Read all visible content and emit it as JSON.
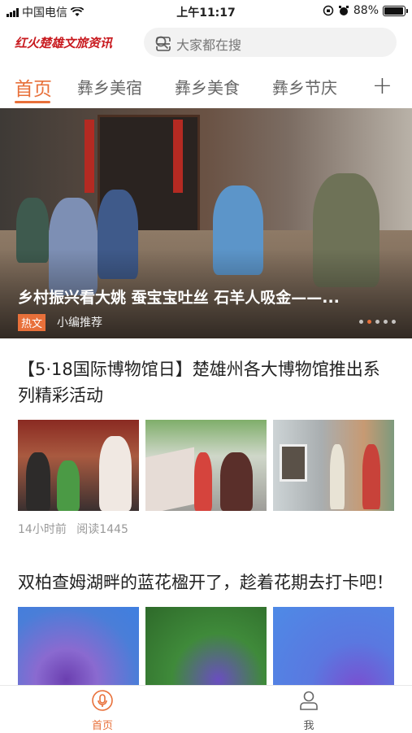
{
  "status_bar": {
    "carrier": "中国电信",
    "time": "上午11:17",
    "battery": "88%"
  },
  "header": {
    "logo_text": "红火楚雄文旅资讯",
    "search_placeholder": "大家都在搜"
  },
  "tabs": [
    {
      "label": "首页",
      "active": true
    },
    {
      "label": "彝乡美宿",
      "active": false
    },
    {
      "label": "彝乡美食",
      "active": false
    },
    {
      "label": "彝乡节庆",
      "active": false
    }
  ],
  "add_tab_label": "+",
  "banner": {
    "title": "乡村振兴看大姚 蚕宝宝吐丝 石羊人吸金——...",
    "badge": "热文",
    "source": "小编推荐",
    "dots_total": 5,
    "dot_active": 1
  },
  "articles": [
    {
      "title": "【5·18国际博物馆日】楚雄州各大博物馆推出系列精彩活动",
      "time": "14小时前",
      "reads": "阅读1445"
    },
    {
      "title": "双柏查姆湖畔的蓝花楹开了，趁着花期去打卡吧！"
    }
  ],
  "bottom_nav": [
    {
      "label": "首页",
      "icon": "microphone-icon",
      "active": true
    },
    {
      "label": "我",
      "icon": "person-icon",
      "active": false
    }
  ],
  "colors": {
    "accent": "#e8703a",
    "logo": "#c8191e"
  }
}
